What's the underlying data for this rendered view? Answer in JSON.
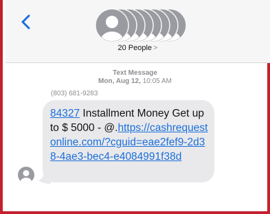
{
  "header": {
    "group_label": "20 People",
    "group_chevron": ">"
  },
  "thread": {
    "service_label": "Text Message",
    "date_label": "Mon, Aug 12,",
    "time_label": "10:05 AM",
    "sender_number": "(803) 681-9283"
  },
  "message": {
    "code_link": "84327",
    "body_text": " Installment Money Get up to $ 5000 - @.",
    "url_text": "https://cashrequestonline.com/?cguid=eae2fef9-2d38-4ae3-bec4-e4084991f38d"
  },
  "colors": {
    "accent": "#1a6fdb",
    "frame_border": "#c4202e",
    "bubble": "#e9e9eb",
    "avatar": "#9a9ba0"
  },
  "icons": {
    "back": "chevron-left-icon",
    "group": "group-avatar-stack-icon",
    "sender": "person-avatar-icon"
  }
}
